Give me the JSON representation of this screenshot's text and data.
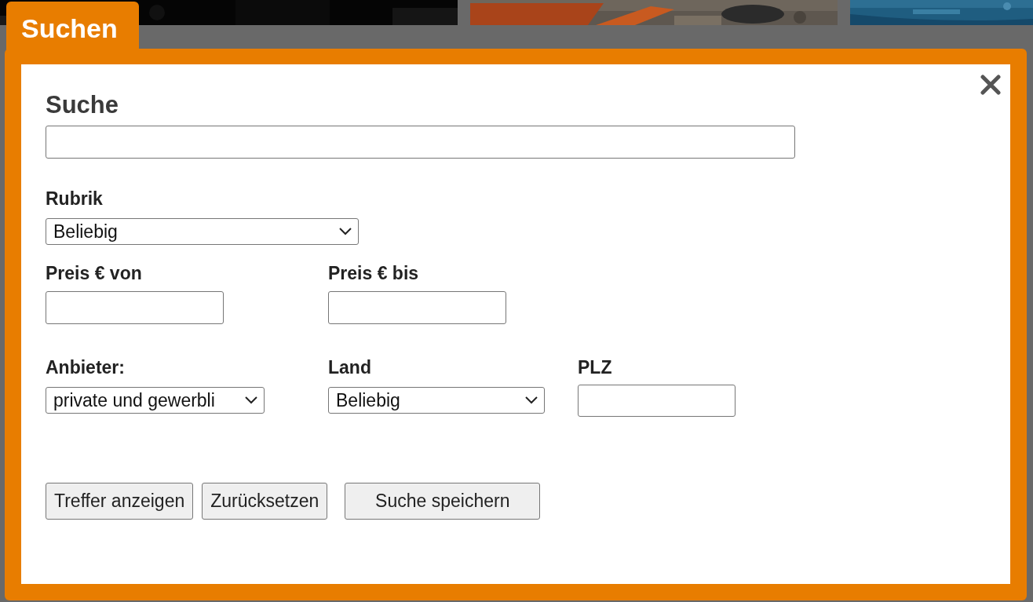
{
  "tab": {
    "label": "Suchen"
  },
  "dialog": {
    "rows": [
      [
        {
          "kind": "text",
          "label": "Suche"
        }
      ],
      [
        {
          "kind": "select",
          "label": "Rubrik",
          "value": "Beliebig"
        }
      ],
      [
        {
          "kind": "text",
          "label": "Preis € von"
        },
        {
          "kind": "text",
          "label": "Preis € bis"
        }
      ],
      [
        {
          "kind": "select",
          "label": "Anbieter:",
          "value": "private und gewerbli"
        },
        {
          "kind": "select",
          "label": "Land",
          "value": "Beliebig"
        },
        {
          "kind": "text",
          "label": "PLZ"
        }
      ]
    ],
    "buttons": [
      "Treffer anzeigen",
      "Zurücksetzen",
      "Suche speichern"
    ]
  }
}
